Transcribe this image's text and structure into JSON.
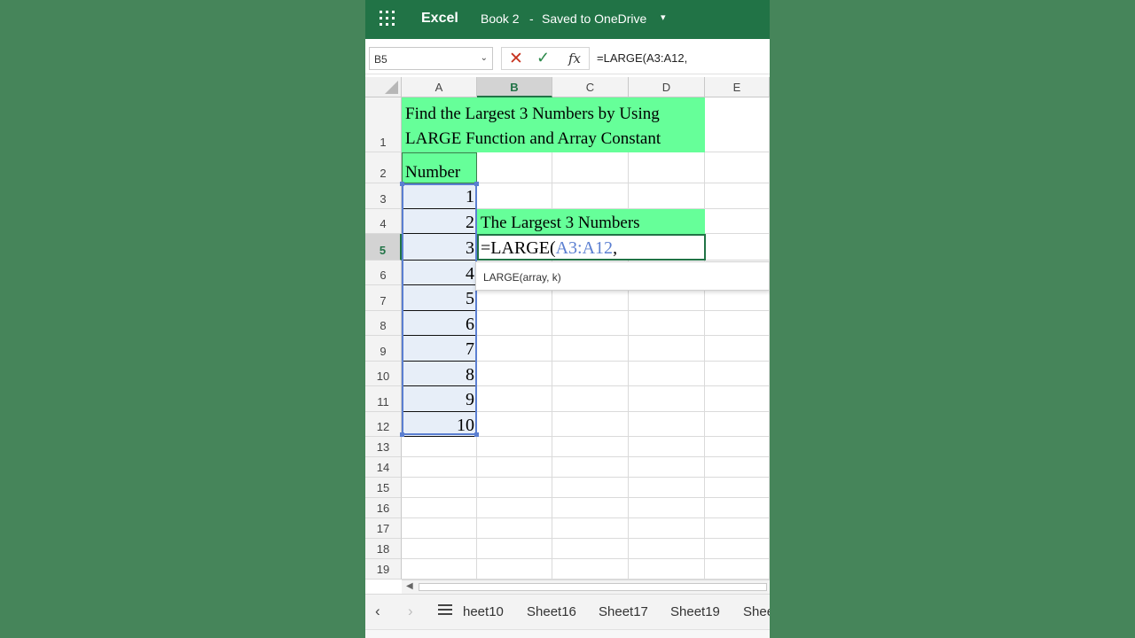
{
  "app": {
    "name": "Excel",
    "doc_title": "Book 2",
    "separator": "-",
    "save_status": "Saved to OneDrive",
    "chevron": "⌄"
  },
  "formula_bar": {
    "name_box": "B5",
    "formula": "=LARGE(A3:A12,",
    "fx": "fx"
  },
  "columns": [
    "A",
    "B",
    "C",
    "D",
    "E"
  ],
  "active_column": "B",
  "rows": [
    "1",
    "2",
    "3",
    "4",
    "5",
    "6",
    "7",
    "8",
    "9",
    "10",
    "11",
    "12",
    "13",
    "14",
    "15",
    "16",
    "17",
    "18",
    "19"
  ],
  "active_row": "5",
  "cells": {
    "A1": "Find the Largest 3 Numbers by Using LARGE Function and Array Constant",
    "A2": "Number",
    "values": [
      "1",
      "2",
      "3",
      "4",
      "5",
      "6",
      "7",
      "8",
      "9",
      "10"
    ],
    "B4": "The Largest 3 Numbers",
    "B5_prefix": "=LARGE(",
    "B5_ref": "A3:A12",
    "B5_suffix": ","
  },
  "tooltip": "LARGE(array, k)",
  "sheet_tabs": [
    "heet10",
    "Sheet16",
    "Sheet17",
    "Sheet19",
    "Shee"
  ],
  "colors": {
    "brand": "#217346",
    "header_fill": "#66ff99",
    "range_ref": "#5b7fd1",
    "cancel": "#c7331f",
    "enter": "#2d8a4b"
  },
  "icons": [
    "app-launcher-icon",
    "cancel-icon",
    "enter-icon",
    "insert-function-icon",
    "sheet-list-icon"
  ]
}
